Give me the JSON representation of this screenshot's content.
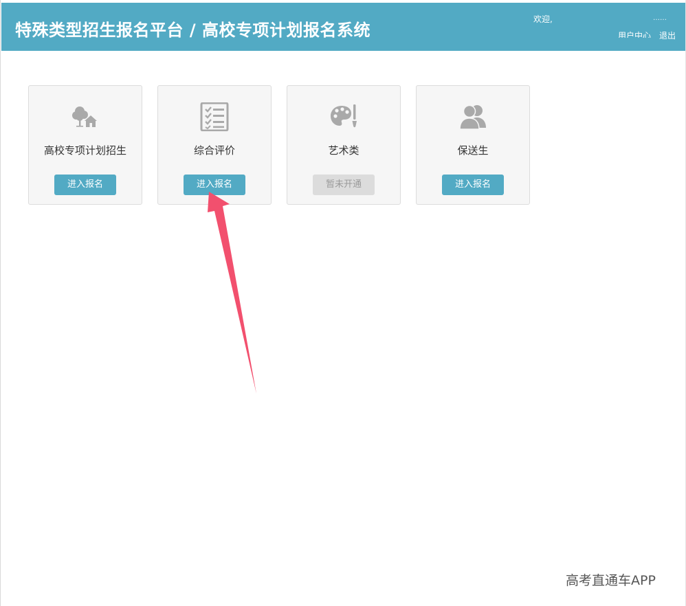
{
  "header": {
    "title": "特殊类型招生报名平台 / 高校专项计划报名系统",
    "welcome": "欢迎,",
    "welcome_suffix": "……",
    "user_center": "用户中心",
    "logout": "退出"
  },
  "cards": [
    {
      "title": "高校专项计划招生",
      "icon": "tree-house-icon",
      "button": "进入报名",
      "status": "active"
    },
    {
      "title": "综合评价",
      "icon": "checklist-icon",
      "button": "进入报名",
      "status": "active"
    },
    {
      "title": "艺术类",
      "icon": "palette-icon",
      "button": "暂未开通",
      "status": "disabled"
    },
    {
      "title": "保送生",
      "icon": "users-icon",
      "button": "进入报名",
      "status": "active"
    }
  ],
  "annotation": {
    "type": "arrow",
    "color": "#f2506e",
    "points_to": "cards.1.button"
  },
  "colors": {
    "header_bg": "#52aac4",
    "button_bg": "#52aac4",
    "disabled_bg": "#dcdcdc",
    "icon": "#a9a9a9"
  },
  "watermark": "高考直通车APP"
}
